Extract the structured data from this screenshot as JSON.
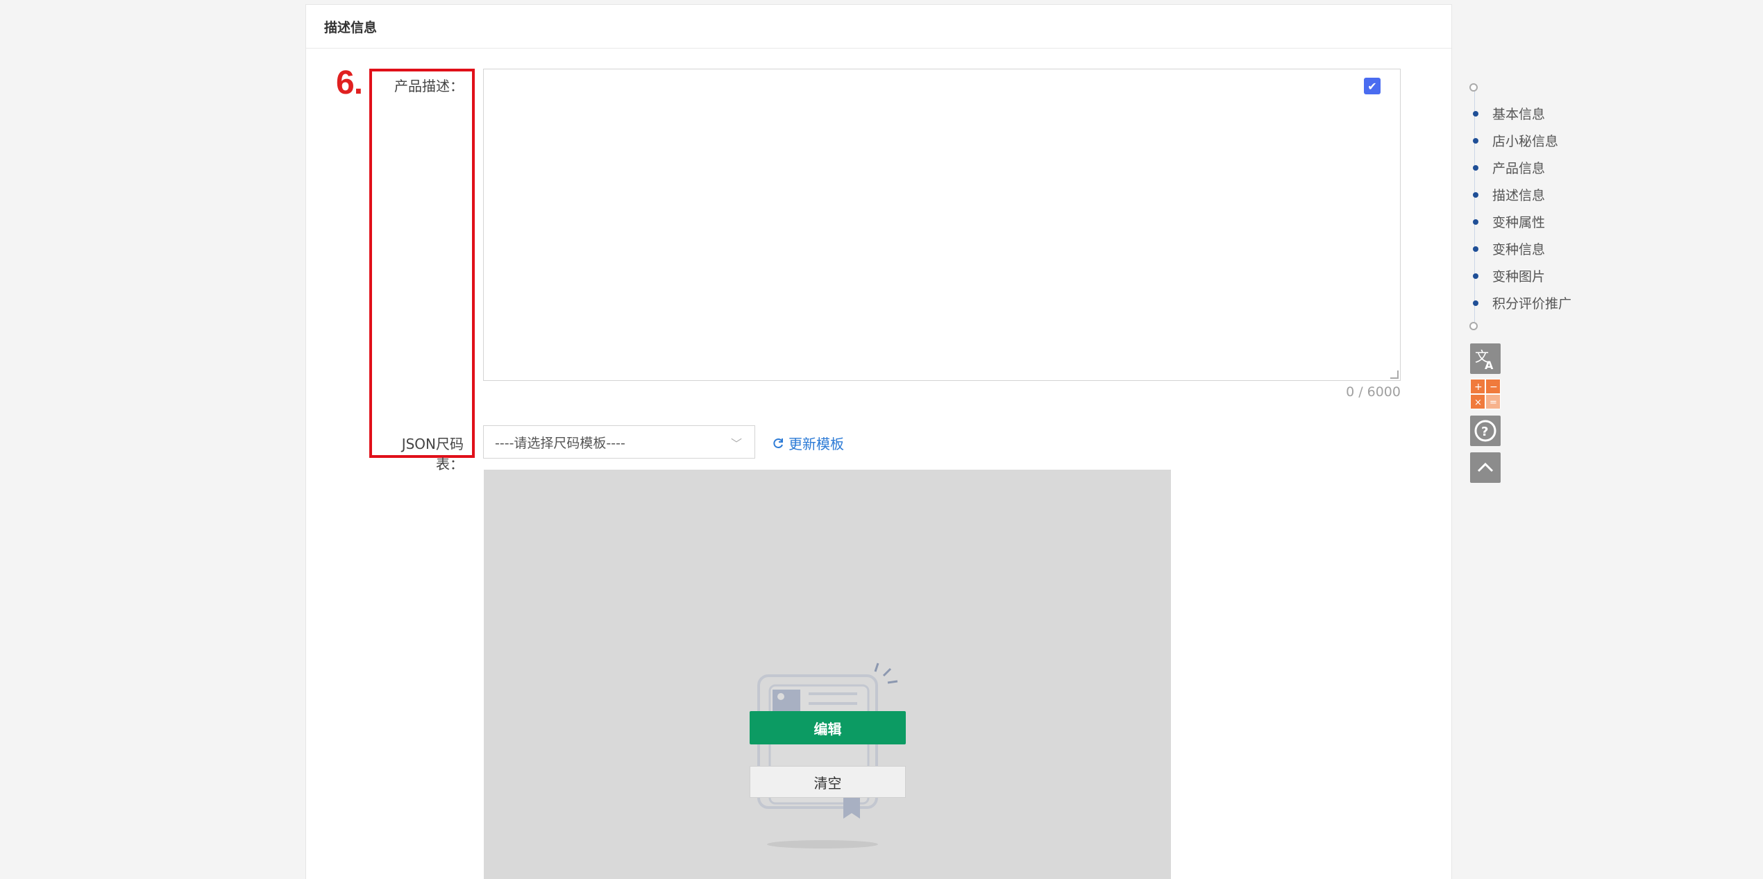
{
  "section": {
    "title": "描述信息"
  },
  "annotation": {
    "step": "6."
  },
  "form": {
    "desc_label": "产品描述：",
    "json_label": "JSON尺码表：",
    "counter": "0 / 6000",
    "select_placeholder": "----请选择尺码模板----",
    "refresh_label": "更新模板"
  },
  "preview": {
    "edit_label": "编辑",
    "clear_label": "清空"
  },
  "nav": {
    "items": [
      {
        "label": "基本信息"
      },
      {
        "label": "店小秘信息"
      },
      {
        "label": "产品信息"
      },
      {
        "label": "描述信息"
      },
      {
        "label": "变种属性"
      },
      {
        "label": "变种信息"
      },
      {
        "label": "变种图片"
      },
      {
        "label": "积分评价推广"
      }
    ]
  },
  "tools": [
    "translate-icon",
    "calculator-icon",
    "help-icon",
    "back-to-top-icon"
  ],
  "colors": {
    "accent_green": "#0c9b63",
    "link_blue": "#2d7bd6",
    "highlight_red": "#e0101a",
    "nav_dot": "#1f4f96"
  }
}
